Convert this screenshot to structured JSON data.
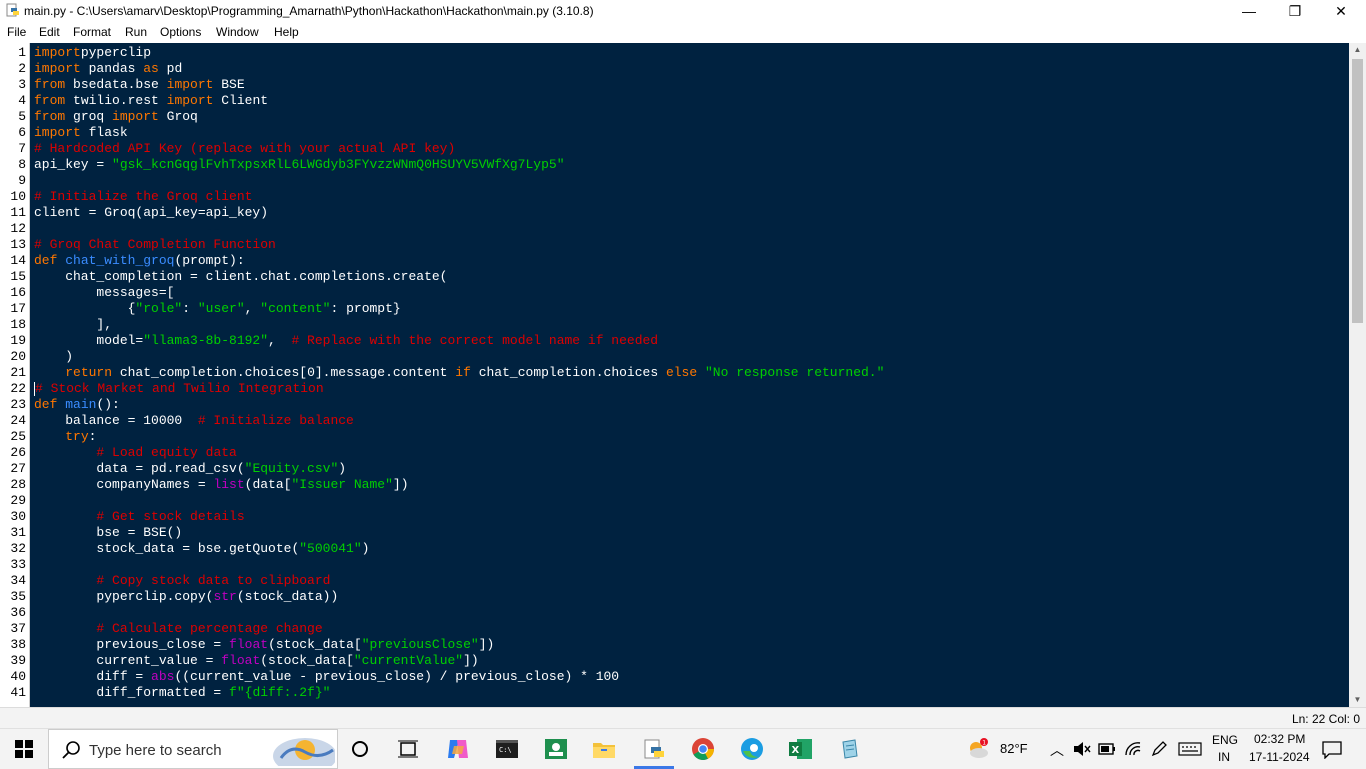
{
  "window": {
    "title": "main.py - C:\\Users\\amarv\\Desktop\\Programming_Amarnath\\Python\\Hackathon\\Hackathon\\main.py (3.10.8)",
    "minimize": "—",
    "maximize": "❐",
    "close": "✕"
  },
  "menu": [
    "File",
    "Edit",
    "Format",
    "Run",
    "Options",
    "Window",
    "Help"
  ],
  "code_lines": [
    [
      [
        "kw",
        "import"
      ],
      [
        "",
        "pyperclip"
      ]
    ],
    [
      [
        "kw",
        "import"
      ],
      [
        "",
        " pandas "
      ],
      [
        "kw",
        "as"
      ],
      [
        "",
        " pd"
      ]
    ],
    [
      [
        "kw",
        "from"
      ],
      [
        "",
        " bsedata.bse "
      ],
      [
        "kw",
        "import"
      ],
      [
        "",
        " BSE"
      ]
    ],
    [
      [
        "kw",
        "from"
      ],
      [
        "",
        " twilio.rest "
      ],
      [
        "kw",
        "import"
      ],
      [
        "",
        " Client"
      ]
    ],
    [
      [
        "kw",
        "from"
      ],
      [
        "",
        " groq "
      ],
      [
        "kw",
        "import"
      ],
      [
        "",
        " Groq"
      ]
    ],
    [
      [
        "kw",
        "import"
      ],
      [
        "",
        " flask"
      ]
    ],
    [
      [
        "cmt",
        "# Hardcoded API Key (replace with your actual API key)"
      ]
    ],
    [
      [
        "",
        "api_key = "
      ],
      [
        "str",
        "\"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\""
      ]
    ],
    [],
    [
      [
        "cmt",
        "# Initialize the Groq client"
      ]
    ],
    [
      [
        "",
        "client = Groq(api_key=api_key)"
      ]
    ],
    [],
    [
      [
        "cmt",
        "# Groq Chat Completion Function"
      ]
    ],
    [
      [
        "kw",
        "def"
      ],
      [
        "",
        " "
      ],
      [
        "def",
        "chat_with_groq"
      ],
      [
        "",
        "(prompt):"
      ]
    ],
    [
      [
        "",
        "    chat_completion = client.chat.completions.create("
      ]
    ],
    [
      [
        "",
        "        messages=["
      ]
    ],
    [
      [
        "",
        "            {"
      ],
      [
        "str",
        "\"role\""
      ],
      [
        "",
        ": "
      ],
      [
        "str",
        "\"user\""
      ],
      [
        "",
        ", "
      ],
      [
        "str",
        "\"content\""
      ],
      [
        "",
        ": prompt}"
      ]
    ],
    [
      [
        "",
        "        ],"
      ]
    ],
    [
      [
        "",
        "        model="
      ],
      [
        "str",
        "\"llama3-8b-8192\""
      ],
      [
        "",
        ",  "
      ],
      [
        "cmt",
        "# Replace with the correct model name if needed"
      ]
    ],
    [
      [
        "",
        "    )"
      ]
    ],
    [
      [
        "",
        "    "
      ],
      [
        "kw",
        "return"
      ],
      [
        "",
        " chat_completion.choices[0].message.content "
      ],
      [
        "kw",
        "if"
      ],
      [
        "",
        " chat_completion.choices "
      ],
      [
        "kw",
        "else"
      ],
      [
        "",
        " "
      ],
      [
        "str",
        "\"No response returned.\""
      ]
    ],
    [
      [
        "cur",
        ""
      ],
      [
        "cmt",
        "# Stock Market and Twilio Integration"
      ]
    ],
    [
      [
        "kw",
        "def"
      ],
      [
        "",
        " "
      ],
      [
        "def",
        "main"
      ],
      [
        "",
        "():"
      ]
    ],
    [
      [
        "",
        "    balance = 10000  "
      ],
      [
        "cmt",
        "# Initialize balance"
      ]
    ],
    [
      [
        "",
        "    "
      ],
      [
        "kw",
        "try"
      ],
      [
        "",
        ":"
      ]
    ],
    [
      [
        "",
        "        "
      ],
      [
        "cmt",
        "# Load equity data"
      ]
    ],
    [
      [
        "",
        "        data = pd.read_csv("
      ],
      [
        "str",
        "\"Equity.csv\""
      ],
      [
        "",
        ")"
      ]
    ],
    [
      [
        "",
        "        companyNames = "
      ],
      [
        "bi",
        "list"
      ],
      [
        "",
        "(data["
      ],
      [
        "str",
        "\"Issuer Name\""
      ],
      [
        "",
        "])"
      ]
    ],
    [],
    [
      [
        "",
        "        "
      ],
      [
        "cmt",
        "# Get stock details"
      ]
    ],
    [
      [
        "",
        "        bse = BSE()"
      ]
    ],
    [
      [
        "",
        "        stock_data = bse.getQuote("
      ],
      [
        "str",
        "\"500041\""
      ],
      [
        "",
        ")"
      ]
    ],
    [],
    [
      [
        "",
        "        "
      ],
      [
        "cmt",
        "# Copy stock data to clipboard"
      ]
    ],
    [
      [
        "",
        "        pyperclip.copy("
      ],
      [
        "bi",
        "str"
      ],
      [
        "",
        "(stock_data))"
      ]
    ],
    [],
    [
      [
        "",
        "        "
      ],
      [
        "cmt",
        "# Calculate percentage change"
      ]
    ],
    [
      [
        "",
        "        previous_close = "
      ],
      [
        "bi",
        "float"
      ],
      [
        "",
        "(stock_data["
      ],
      [
        "str",
        "\"previousClose\""
      ],
      [
        "",
        "])"
      ]
    ],
    [
      [
        "",
        "        current_value = "
      ],
      [
        "bi",
        "float"
      ],
      [
        "",
        "(stock_data["
      ],
      [
        "str",
        "\"currentValue\""
      ],
      [
        "",
        "])"
      ]
    ],
    [
      [
        "",
        "        diff = "
      ],
      [
        "bi",
        "abs"
      ],
      [
        "",
        "((current_value - previous_close) / previous_close) * 100"
      ]
    ],
    [
      [
        "",
        "        diff_formatted = "
      ],
      [
        "str",
        "f\"{diff:.2f}\""
      ]
    ]
  ],
  "status": {
    "text": "Ln: 22   Col: 0"
  },
  "taskbar": {
    "search_placeholder": "Type here to search",
    "weather": "82°F",
    "weather_badge": "1",
    "lang_top": "ENG",
    "lang_bottom": "IN",
    "time": "02:32 PM",
    "date": "17-11-2024"
  }
}
